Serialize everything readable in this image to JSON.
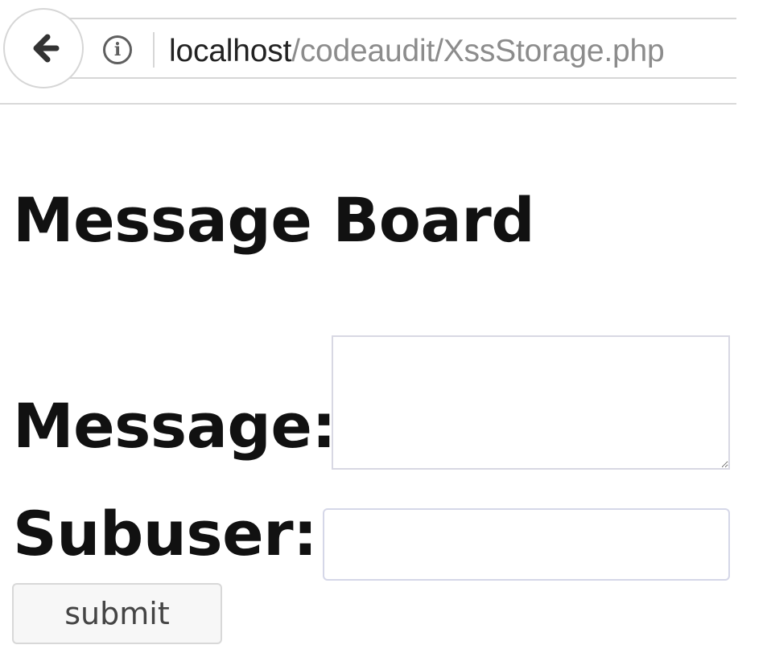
{
  "browser": {
    "back_icon": "back-arrow-icon",
    "info_icon": "info-icon",
    "info_symbol": "i",
    "url_host": "localhost",
    "url_path": "/codeaudit/XssStorage.php"
  },
  "page": {
    "title": "Message Board"
  },
  "form": {
    "message_label": "Message:",
    "message_value": "",
    "subuser_label": "Subuser:",
    "subuser_value": "",
    "submit_label": "submit"
  },
  "colors": {
    "page_background": "#ffffff",
    "text": "#111111",
    "url_host": "#222222",
    "url_path": "#8c8c8c",
    "border": "#d8d8d8"
  }
}
